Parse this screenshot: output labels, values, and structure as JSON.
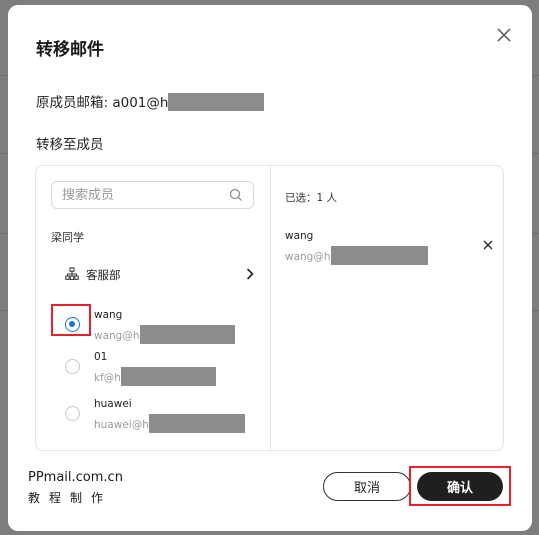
{
  "dialog": {
    "title": "转移邮件",
    "original_email_label": "原成员邮箱: a001@h",
    "transfer_to_label": "转移至成员"
  },
  "left_panel": {
    "search_placeholder": "搜索成员",
    "group_label": "梁同学",
    "department": "客服部",
    "members": [
      {
        "name": "wang",
        "email": "wang@h",
        "selected": true
      },
      {
        "name": "01",
        "email": "kf@h",
        "selected": false
      },
      {
        "name": "huawei",
        "email": "huawei@h",
        "selected": false
      }
    ]
  },
  "right_panel": {
    "selected_count_label": "已选：1 人",
    "selected": [
      {
        "name": "wang",
        "email": "wang@h"
      }
    ]
  },
  "footer": {
    "brand_line1": "PPmail.com.cn",
    "brand_line2": "教程制作",
    "cancel_label": "取消",
    "confirm_label": "确认"
  },
  "colors": {
    "accent": "#1a73e8",
    "annotation": "#e8202a",
    "primary_button": "#1f1f1f"
  }
}
